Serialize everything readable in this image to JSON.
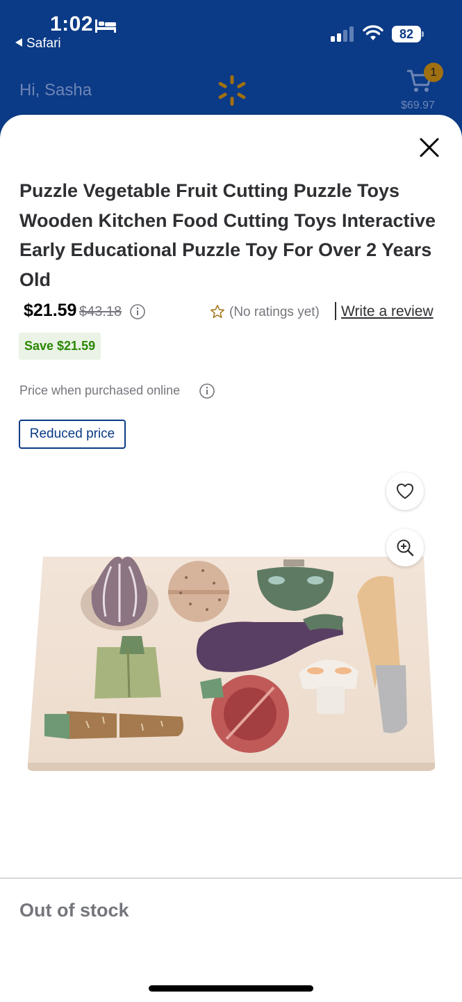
{
  "status_bar": {
    "time": "1:02",
    "back_app": "Safari",
    "battery": "82"
  },
  "header": {
    "greeting": "Hi, Sasha",
    "cart_count": "1",
    "cart_total": "$69.97",
    "brand_color": "#0b3a86",
    "spark_color": "#a07010"
  },
  "product": {
    "title": "Puzzle Vegetable Fruit Cutting Puzzle Toys Wooden Kitchen Food Cutting Toys Interactive Early Educational Puzzle Toy For Over 2 Years Old",
    "price": "$21.59",
    "was_price": "$43.18",
    "ratings": "(No ratings yet)",
    "write_review": "Write a review",
    "save": "Save $21.59",
    "price_note": "Price when purchased online",
    "reduced_label": "Reduced price",
    "image_desc_icon": "wooden-food-puzzle-image"
  },
  "footer": {
    "stock": "Out of stock"
  },
  "icons": [
    "bed-icon",
    "signal-icon",
    "wifi-icon",
    "spark-icon",
    "cart-icon",
    "close-icon",
    "info-icon",
    "star-icon",
    "heart-icon",
    "zoom-in-icon"
  ]
}
